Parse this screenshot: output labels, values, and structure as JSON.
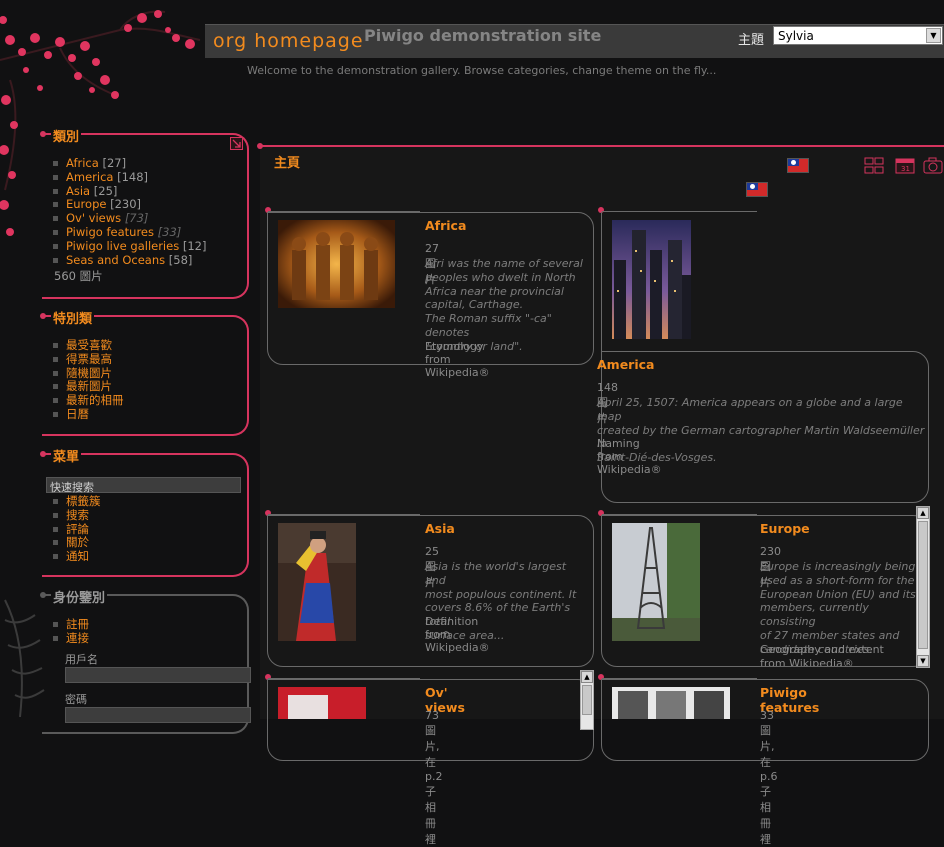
{
  "header": {
    "home_link": "org homepage",
    "site_title": "Piwigo demonstration site",
    "theme_label": "主題",
    "theme_value": "Sylvia",
    "welcome": "Welcome to the demonstration gallery. Browse categories, change theme on the fly..."
  },
  "sidebar": {
    "categories": {
      "title": "類別",
      "items": [
        {
          "name": "Africa",
          "count": "[27]"
        },
        {
          "name": "America",
          "count": "[148]"
        },
        {
          "name": "Asia",
          "count": "[25]"
        },
        {
          "name": "Europe",
          "count": "[230]"
        },
        {
          "name": "Ov' views",
          "count": "[73]"
        },
        {
          "name": "Piwigo features",
          "count": "[33]"
        },
        {
          "name": "Piwigo live galleries",
          "count": "[12]"
        },
        {
          "name": "Seas and Oceans",
          "count": "[58]"
        }
      ],
      "total": "560 圖片"
    },
    "specials": {
      "title": "特別類",
      "items": [
        "最受喜歡",
        "得票最高",
        "隨機圖片",
        "最新圖片",
        "最新的相冊",
        "日曆"
      ]
    },
    "menu": {
      "title": "菜單",
      "quick_search": "快速搜索",
      "items": [
        "標籤簇",
        "搜索",
        "評論",
        "關於",
        "通知"
      ]
    },
    "identification": {
      "title": "身份鑒別",
      "items": [
        "註冊",
        "連接"
      ],
      "username_label": "用戶名",
      "password_label": "密碼"
    }
  },
  "main": {
    "title": "主頁",
    "cards": [
      {
        "name": "Africa",
        "count": "27 圖片",
        "desc": [
          "Afri was the name of several",
          "peoples who dwelt in North",
          "Africa near the provincial",
          "capital, Carthage.",
          "The Roman suffix \"-ca\" denotes",
          "\"country or land\"."
        ],
        "source": "Etymology from Wikipedia®"
      },
      {
        "name": "America",
        "count": "148 圖片",
        "desc": [
          "April 25, 1507: America appears on a globe and a large map",
          "created by the German cartographer Martin Waldseemüller in",
          "Saint-Dié-des-Vosges."
        ],
        "source": "Naming from Wikipedia®"
      },
      {
        "name": "Asia",
        "count": "25 圖片",
        "desc": [
          "Asia is the world's largest and",
          "most populous continent. It",
          "covers 8.6% of the Earth's total",
          "surface area..."
        ],
        "source": "Definition from Wikipedia®"
      },
      {
        "name": "Europe",
        "count": "230 圖片",
        "desc": [
          "Europe is increasingly being",
          "used as a short-form for the",
          "European Union (EU) and its",
          "members, currently consisting",
          "of 27 member states and",
          "candidate countries."
        ],
        "source": "Geography and extent from Wikipedia®"
      },
      {
        "name": "Ov' views",
        "count": "73 圖片, 在p.2 子相冊裡"
      },
      {
        "name": "Piwigo features",
        "count": "33 圖片, 在p.6 子相冊裡"
      }
    ]
  },
  "colors": {
    "accent": "#f28b1e",
    "pink": "#d6345e",
    "bg": "#111112"
  }
}
